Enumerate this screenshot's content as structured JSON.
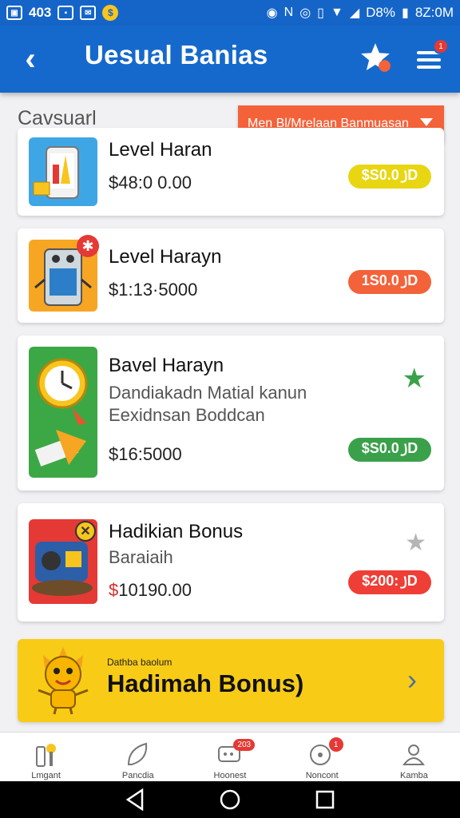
{
  "status_bar": {
    "left_text": "403",
    "battery": "D8%",
    "time": "8Z:0M"
  },
  "appbar": {
    "title": "Uesual Banias",
    "menu_badge": "1"
  },
  "filter": {
    "category_label": "Cavsuarl",
    "dropdown_value": "Men Bl/Mrelaan Banmuasan"
  },
  "products": [
    {
      "title": "Level Haran",
      "price": "$48:0 0.00",
      "pill": "$S0.0 ꠸D",
      "pill_color": "#e8d613"
    },
    {
      "title": "Level Harayn",
      "price": "$1:13·5000",
      "pill": "1S0.0 ꠸D",
      "pill_color": "#f4623a"
    },
    {
      "title": "Bavel Harayn",
      "desc_line1": "Dandiakadn Matial kanun",
      "desc_line2": "Eexidnsan Boddcan",
      "price": "$16:5000",
      "pill": "$S0.0 ꠸D",
      "pill_color": "#3aa14a",
      "star": "★",
      "star_color": "#3aa14a"
    },
    {
      "title": "Hadikian Bonus",
      "desc_line1": "Baraiaih",
      "price_prefix": "$",
      "price": "10190.00",
      "pill": "$200: ꠸D",
      "pill_color": "#ef3e36",
      "star": "★",
      "star_color": "#b5b5b5"
    }
  ],
  "bonus": {
    "small_text": "Dathba baolum",
    "title": "Hadimah Bonus)"
  },
  "bottom_nav": [
    {
      "label": "Lmgant"
    },
    {
      "label": "Pancdia"
    },
    {
      "label": "Hoonest",
      "badge": "203"
    },
    {
      "label": "Noncont",
      "badge": "1"
    },
    {
      "label": "Kamba"
    }
  ],
  "colors": {
    "primary": "#1669cc",
    "accent_orange": "#f4623a",
    "bonus_yellow": "#f8cb17"
  }
}
